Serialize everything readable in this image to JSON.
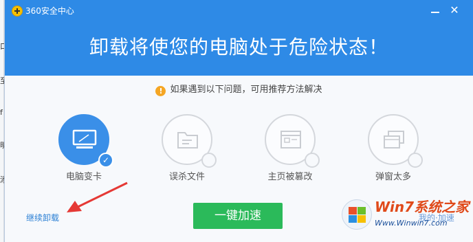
{
  "window": {
    "title": "360安全中心",
    "close_glyph": "✕"
  },
  "left_edge_glyphs": [
    "口",
    "至",
    "f",
    "明",
    "添"
  ],
  "header": {
    "headline": "卸载将使您的电脑处于危险状态！"
  },
  "notice": {
    "icon": "info-icon",
    "icon_glyph": "!",
    "text": "如果遇到以下问题，可用推荐方法解决"
  },
  "issues": [
    {
      "label": "电脑变卡",
      "icon": "monitor-icon",
      "active": true,
      "badge_glyph": "✓"
    },
    {
      "label": "误杀文件",
      "icon": "folder-icon",
      "active": false
    },
    {
      "label": "主页被篡改",
      "icon": "browser-page-icon",
      "active": false
    },
    {
      "label": "弹窗太多",
      "icon": "popup-windows-icon",
      "active": false
    }
  ],
  "actions": {
    "continue_uninstall": "继续卸载",
    "one_click_speedup": "一键加速"
  },
  "colors": {
    "header_blue": "#2e8ae6",
    "button_green": "#2bba5a",
    "link_blue": "#2a7fd4",
    "arrow_red": "#e53935"
  },
  "watermark": {
    "text": "Win7系统之家",
    "url": "Www.Winwin7.com",
    "ghost_text": "我的·加速"
  }
}
